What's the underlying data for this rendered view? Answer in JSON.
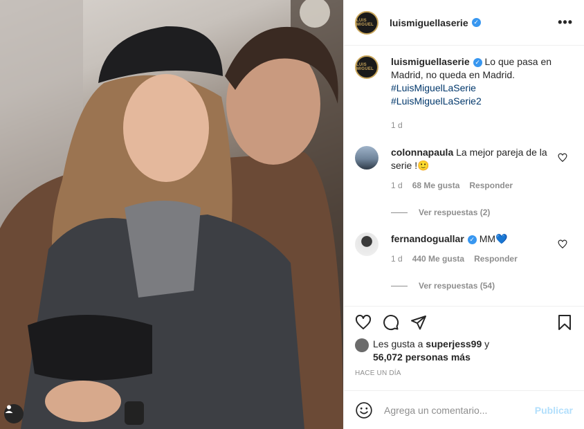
{
  "header": {
    "username": "luismiguellaserie",
    "avatar_text": "LUIS MIGUEL",
    "more_label": "•••"
  },
  "caption": {
    "username": "luismiguellaserie",
    "text": "Lo que pasa en Madrid, no queda en Madrid.",
    "hashtags": [
      "#LuisMiguelLaSerie",
      "#LuisMiguelLaSerie2"
    ],
    "time": "1 d"
  },
  "comments": [
    {
      "username": "colonnapaula",
      "text": "La mejor pareja de la serie !🙂",
      "time": "1 d",
      "likes": "68 Me gusta",
      "reply": "Responder",
      "view_replies": "Ver respuestas (2)"
    },
    {
      "username": "fernandoguallar",
      "text": "MM💙",
      "time": "1 d",
      "likes": "440 Me gusta",
      "reply": "Responder",
      "view_replies": "Ver respuestas (54)"
    }
  ],
  "likes": {
    "prefix": "Les gusta a",
    "user": "superjess99",
    "connector": "y",
    "count": "56,072 personas más"
  },
  "timestamp": "HACE UN DÍA",
  "add_comment": {
    "placeholder": "Agrega un comentario...",
    "publish": "Publicar"
  },
  "colors": {
    "verified": "#3897f0",
    "hashtag": "#00376b",
    "muted": "#8e8e8e",
    "publish_disabled": "#b2dffc"
  },
  "icons": [
    "heart-icon",
    "comment-icon",
    "share-icon",
    "bookmark-icon",
    "emoji-icon",
    "user-tag-icon",
    "more-icon",
    "verified-icon"
  ]
}
